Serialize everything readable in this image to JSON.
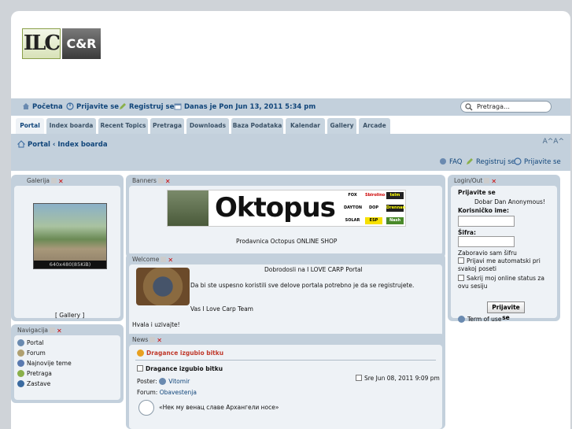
{
  "logo": {
    "left": "ILC",
    "right": "C&R"
  },
  "topbar": {
    "home": "Početna",
    "login": "Prijavite se",
    "register": "Registruj se",
    "date": "Danas je Pon Jun 13, 2011 5:34 pm",
    "search_placeholder": "Pretraga…"
  },
  "tabs": [
    "Portal",
    "Index boarda",
    "Recent Topics",
    "Pretraga",
    "Downloads",
    "Baza Podataka",
    "Kalendar",
    "Gallery",
    "Arcade"
  ],
  "breadcrumb": "Portal ‹ Index boarda",
  "navright": {
    "faq": "FAQ",
    "register": "Registruj se",
    "login": "Prijavite se"
  },
  "gallery": {
    "title": "Galerija",
    "caption": "640x480(85KiB)",
    "link": "[ Gallery ]"
  },
  "navigation": {
    "title": "Navigacija",
    "items": [
      "Portal",
      "Forum",
      "Najnovije teme",
      "Pretraga",
      "Zastave"
    ]
  },
  "banners": {
    "title": "Banners",
    "brand": "Oktopus",
    "logos": [
      "FOX",
      "Sbirolino",
      "telm",
      "DAYTON",
      "DOP",
      "Drennan",
      "SOLAR",
      "ESP",
      "Nash"
    ],
    "caption": "Prodavnica Octopus ONLINE SHOP"
  },
  "welcome": {
    "title": "Welcome",
    "heading": "Dobrodosli na I LOVE CARP Portal",
    "line1": "Da bi ste uspesno koristili sve delove portala potrebno je da se registrujete.",
    "line2": "Vas I Love Carp Team",
    "line3": "Hvala i uzivajte!"
  },
  "news": {
    "title": "News",
    "headline": "Dragance izgubio bitku",
    "post_title": "Dragance izgubio bitku",
    "poster_label": "Poster:",
    "poster": "Vitomir",
    "date": "Sre Jun 08, 2011 9:09 pm",
    "forum_label": "Forum:",
    "forum": "Obavestenja",
    "body": "«Нек му венац славе Архангели носе»"
  },
  "login": {
    "title": "Login/Out",
    "heading": "Prijavite se",
    "greeting": "Dobar Dan Anonymous!",
    "user_label": "Korisničko ime:",
    "pass_label": "Šifra:",
    "forgot": "Zaboravio sam šifru",
    "auto": "Prijavi me automatski pri svakoj poseti",
    "hide": "Sakrij moj online status za ovu sesiju",
    "button": "Prijavite se",
    "terms": "Term of use"
  },
  "colors": {
    "accent": "#10457a",
    "bar": "#c3d0dc",
    "panel_inner": "#eef2f6",
    "news_title": "#c0392b"
  }
}
